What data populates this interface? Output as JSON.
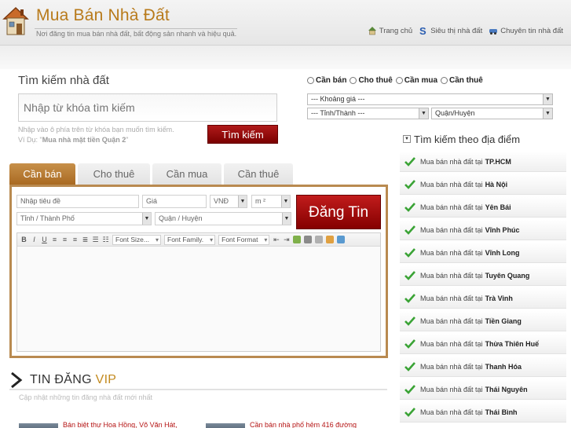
{
  "header": {
    "site_title": "Mua Bán Nhà Đất",
    "tagline": "Nơi đăng tin mua bán nhà đất, bất động sản nhanh và hiệu quả.",
    "nav": [
      {
        "label": "Trang chủ",
        "icon": "home-icon"
      },
      {
        "label": "Siêu thị nhà đất",
        "icon": "s-logo-icon"
      },
      {
        "label": "Chuyên tin nhà đất",
        "icon": "car-icon"
      }
    ]
  },
  "search": {
    "title": "Tìm kiếm nhà đất",
    "placeholder": "Nhập từ khóa tìm kiếm",
    "hint_line1": "Nhập vào ô phía trên từ khóa bạn muốn tìm kiếm.",
    "hint_prefix": "Ví Dụ: \"",
    "hint_example": "Mua nhà mặt tiền Quận 2",
    "hint_suffix": "\"",
    "button": "Tìm kiếm",
    "radios": [
      "Cần bán",
      "Cho thuê",
      "Cần mua",
      "Cần thuê"
    ],
    "price_select": "--- Khoảng giá ---",
    "province_select": "--- Tỉnh/Thành ---",
    "district_select": "Quận/Huyện"
  },
  "locations": {
    "title": "Tìm kiếm theo địa điểm",
    "prefix": "Mua bán nhà đất tại",
    "items": [
      "TP.HCM",
      "Hà Nội",
      "Yên Bái",
      "Vĩnh Phúc",
      "Vĩnh Long",
      "Tuyên Quang",
      "Trà Vinh",
      "Tiền Giang",
      "Thừa Thiên Huế",
      "Thanh Hóa",
      "Thái Nguyên",
      "Thái Bình"
    ]
  },
  "post": {
    "tabs": [
      "Cần bán",
      "Cho thuê",
      "Cần mua",
      "Cần thuê"
    ],
    "active_tab": "Cần bán",
    "title_placeholder": "Nhập tiêu đề",
    "price_placeholder": "Giá",
    "currency": "VNĐ",
    "unit": "m ²",
    "province": "Tỉnh / Thành Phố",
    "district": "Quận / Huyện",
    "button": "Đăng Tin",
    "toolbar": {
      "bold": "B",
      "italic": "I",
      "underline": "U",
      "font_size": "Font Size...",
      "font_family": "Font Family.",
      "font_format": "Font Format"
    }
  },
  "vip": {
    "title_main": "TIN ĐĂNG ",
    "title_accent": "VIP",
    "subtitle": "Cập nhật những tin đăng nhà đất mới nhất",
    "items": [
      "Bán biệt thự Hoa Hồng, Võ Văn Hát,",
      "Cần bán nhà phố hẻm 416 đường"
    ]
  },
  "colors": {
    "brand": "#b87a1a",
    "accent_red": "#8a0000",
    "tab_active": "#b07a30",
    "check_green": "#3aa335"
  }
}
